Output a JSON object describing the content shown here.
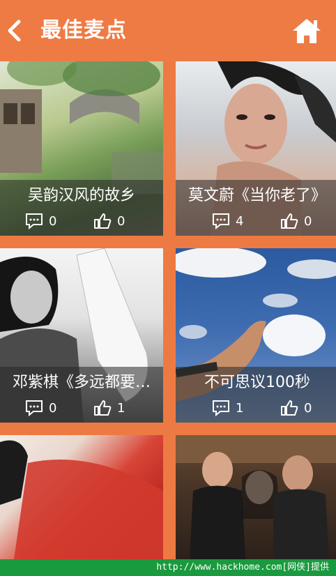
{
  "header": {
    "title": "最佳麦点",
    "back_icon": "chevron-left-icon",
    "home_icon": "home-icon"
  },
  "colors": {
    "accent": "#ee7b44",
    "overlay": "#282828",
    "footer": "#1a9a3e"
  },
  "cards": [
    {
      "caption": "吴韵汉风的故乡",
      "comments": "0",
      "likes": "0"
    },
    {
      "caption": "莫文蔚《当你老了》",
      "comments": "4",
      "likes": "0"
    },
    {
      "caption": "邓紫棋《多远都要…",
      "comments": "0",
      "likes": "1"
    },
    {
      "caption": "不可思议100秒",
      "comments": "1",
      "likes": "0"
    },
    {
      "caption": "",
      "comments": "",
      "likes": ""
    },
    {
      "caption": "",
      "comments": "",
      "likes": ""
    }
  ],
  "watermark": "http://www.hackhome.com[网侠]提供"
}
